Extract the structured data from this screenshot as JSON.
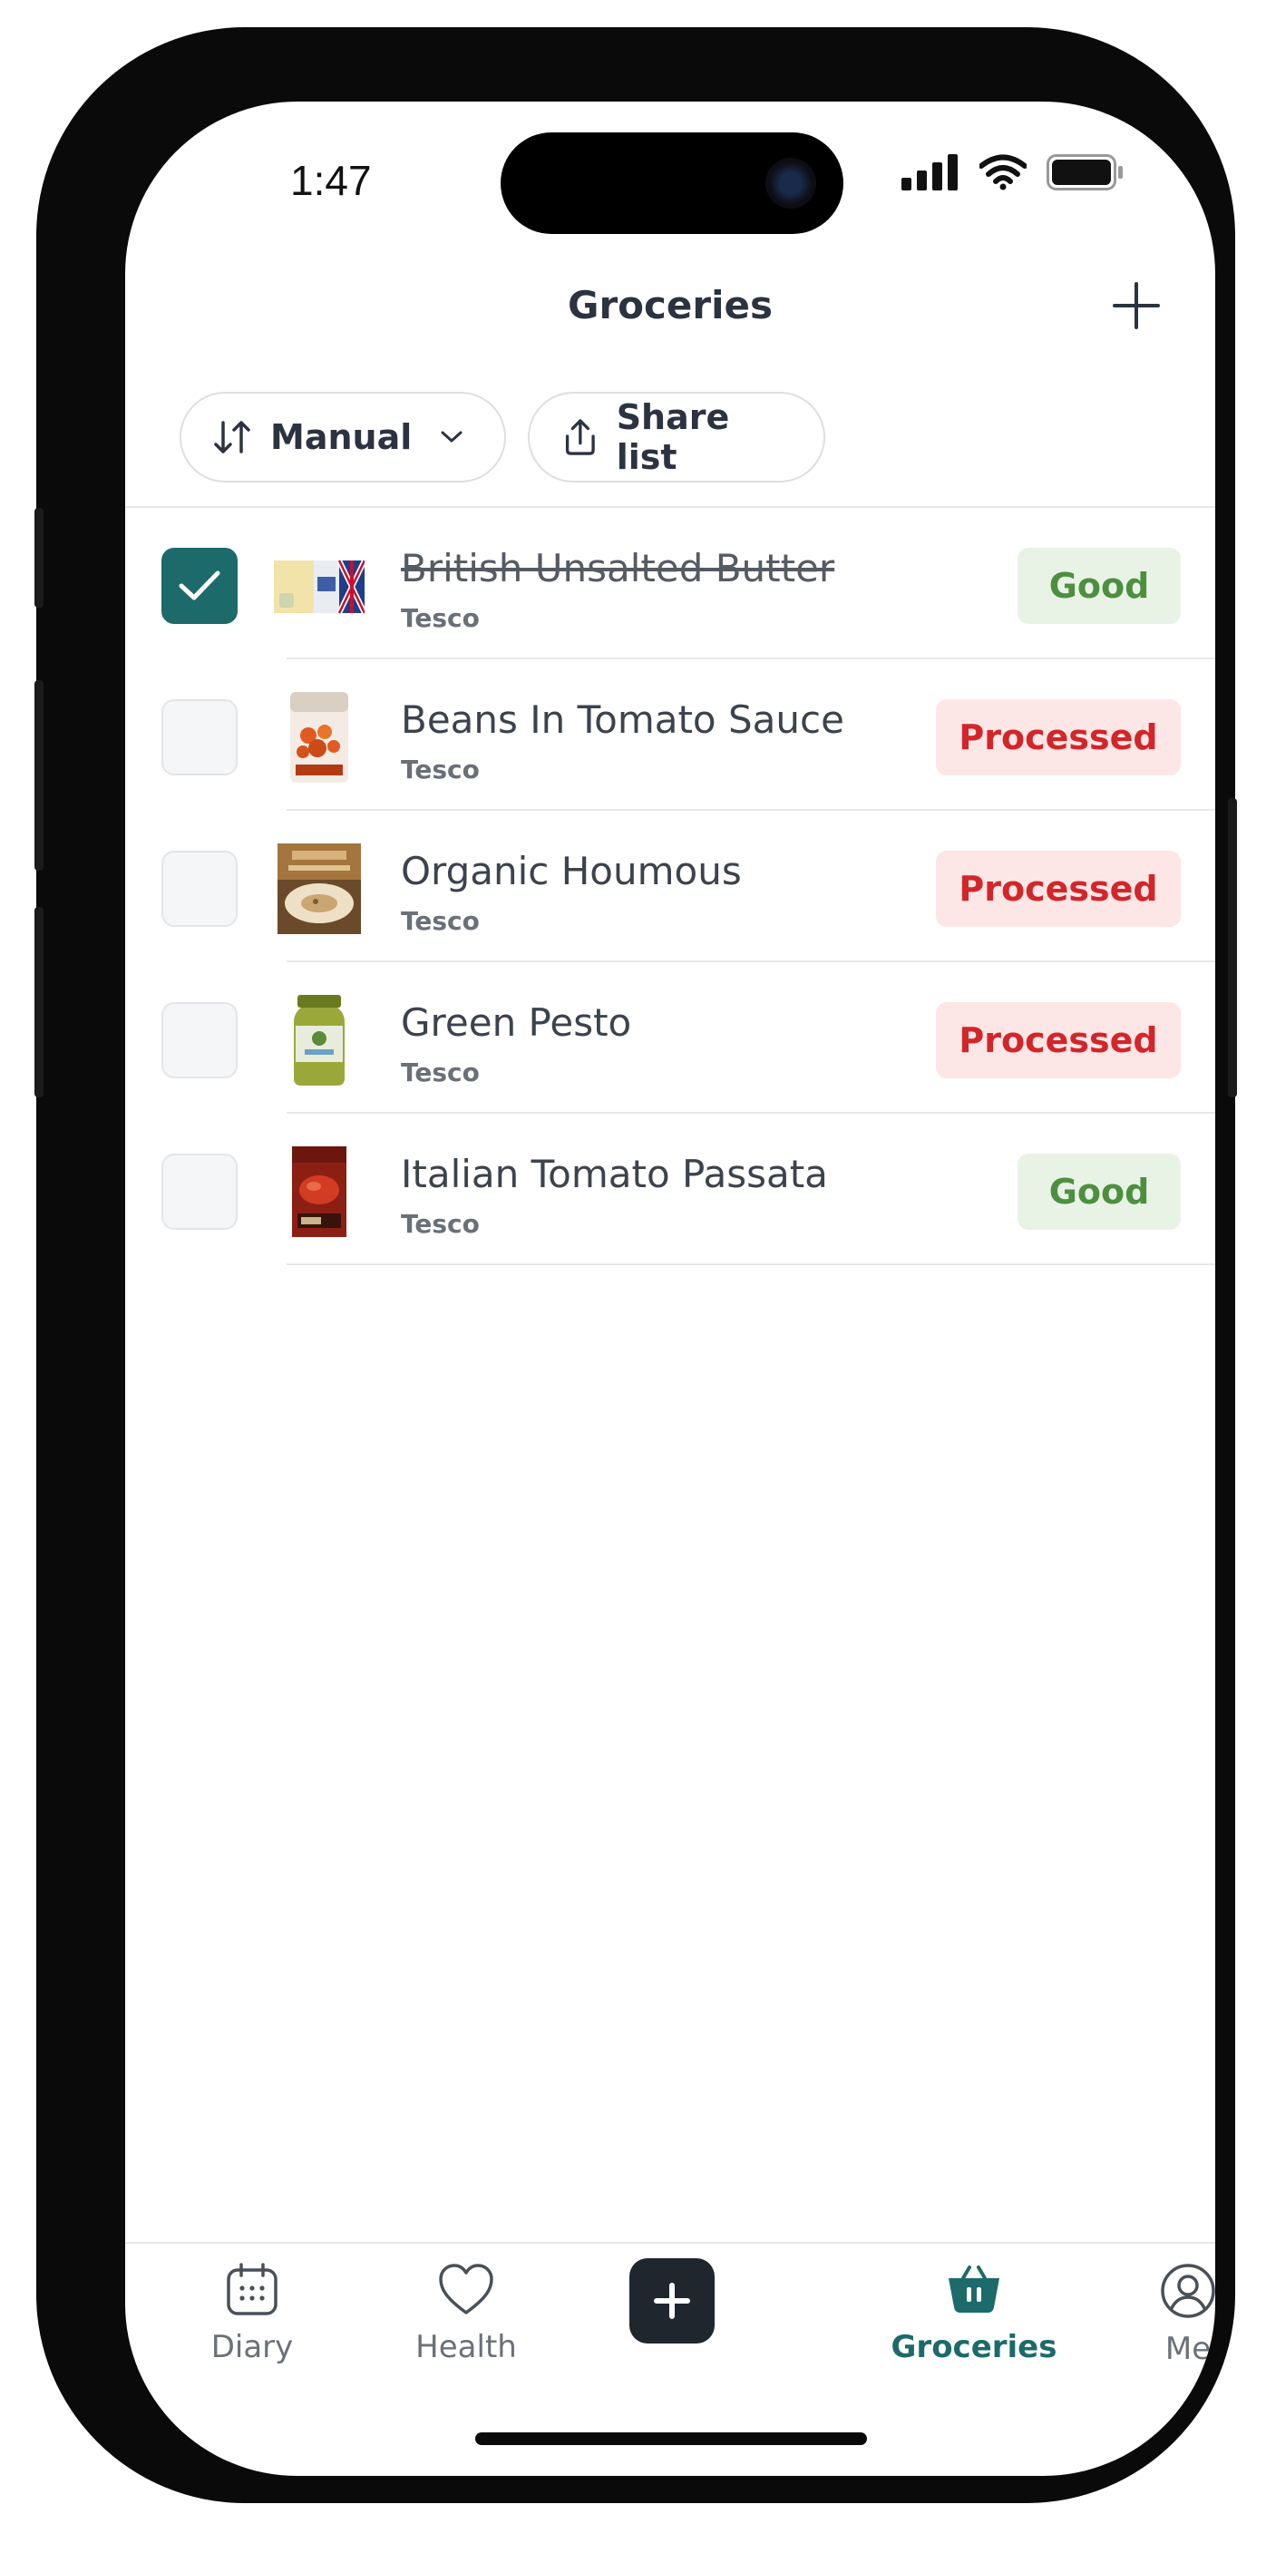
{
  "status_bar": {
    "time": "1:47"
  },
  "header": {
    "title": "Groceries"
  },
  "toolbar": {
    "sort_label": "Manual",
    "share_label": "Share list"
  },
  "items": [
    {
      "name": "British Unsalted Butter",
      "store": "Tesco",
      "rating": "Good",
      "checked": true
    },
    {
      "name": "Beans In Tomato Sauce",
      "store": "Tesco",
      "rating": "Processed",
      "checked": false
    },
    {
      "name": "Organic Houmous",
      "store": "Tesco",
      "rating": "Processed",
      "checked": false
    },
    {
      "name": "Green Pesto",
      "store": "Tesco",
      "rating": "Processed",
      "checked": false
    },
    {
      "name": "Italian Tomato Passata",
      "store": "Tesco",
      "rating": "Good",
      "checked": false
    }
  ],
  "nav": {
    "diary": "Diary",
    "health": "Health",
    "groceries": "Groceries",
    "me": "Me"
  },
  "colors": {
    "accent": "#1d6a6a",
    "good_text": "#4e8f3f",
    "good_bg": "#e8f3e6",
    "processed_text": "#d2262a",
    "processed_bg": "#fde6e6"
  }
}
